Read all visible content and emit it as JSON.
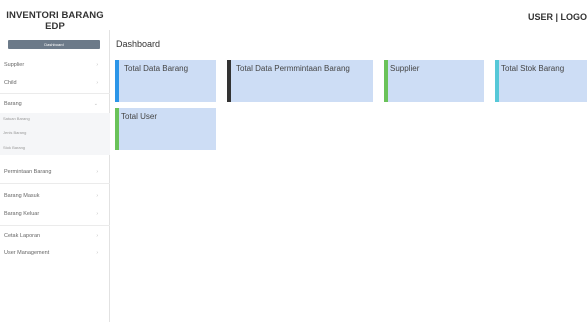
{
  "header": {
    "brand_line1": "INVENTORI BARANG",
    "brand_line2": "EDP",
    "user_menu": "USER | LOGO"
  },
  "sidebar": {
    "dashboard_label": "Dashboard",
    "items": [
      {
        "label": "Supplier"
      },
      {
        "label": "Child"
      },
      {
        "label": "Barang"
      },
      {
        "label": "Permintaan Barang"
      },
      {
        "label": "Barang Masuk"
      },
      {
        "label": "Barang Keluar"
      },
      {
        "label": "Cetak Laporan"
      },
      {
        "label": "User Management"
      }
    ],
    "submenu": [
      {
        "label": "Satuan Barang"
      },
      {
        "label": "Jenis Barang"
      },
      {
        "label": "Stok Barang"
      }
    ]
  },
  "main": {
    "title": "Dashboard",
    "cards": [
      {
        "label": "Total Data Barang",
        "accent": "#2b95e8"
      },
      {
        "label": "Total Data Permmintaan Barang",
        "accent": "#333333"
      },
      {
        "label": "Supplier",
        "accent": "#6ac259"
      },
      {
        "label": "Total Stok Barang",
        "accent": "#56c8d8"
      },
      {
        "label": "Total User",
        "accent": "#6ac259"
      }
    ]
  },
  "colors": {
    "card_bg": "#cdddf5",
    "dashboard_button": "#6c7a89"
  }
}
